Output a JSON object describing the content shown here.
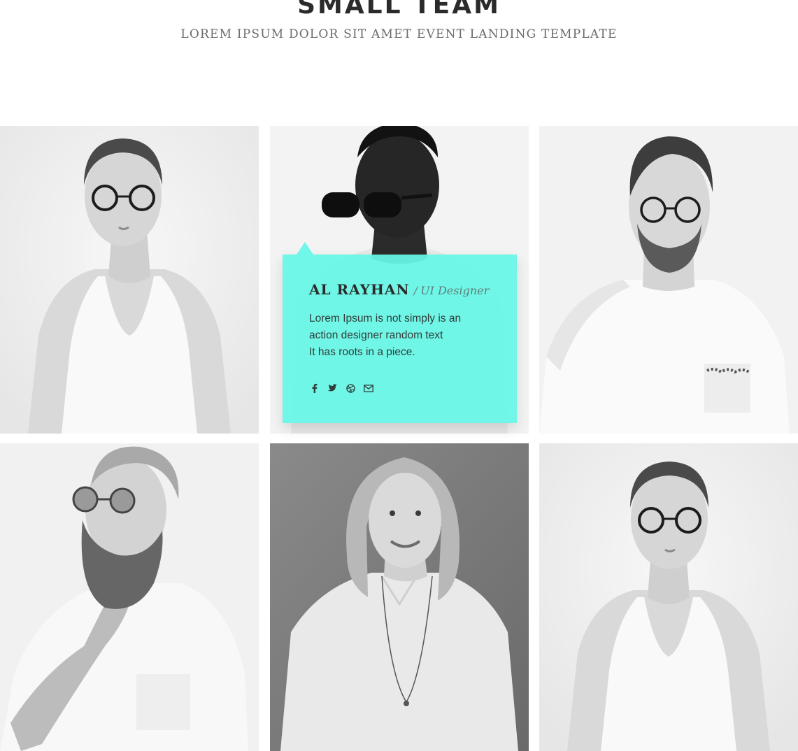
{
  "header": {
    "title": "SMALL TEAM",
    "subtitle": "LOREM IPSUM DOLOR SIT AMET EVENT LANDING TEMPLATE"
  },
  "featured_member": {
    "name": "AL RAYHAN",
    "separator": "/",
    "role": "UI Designer",
    "description_lines": [
      "Lorem Ipsum is not simply is  an",
      "action designer random text",
      "It has roots in a piece."
    ],
    "socials": [
      "facebook-icon",
      "twitter-icon",
      "dribbble-icon",
      "envelope-icon"
    ]
  },
  "colors": {
    "accent": "#68f6e6",
    "title": "#2b2b2b",
    "subtitle": "#6a6a6a"
  }
}
